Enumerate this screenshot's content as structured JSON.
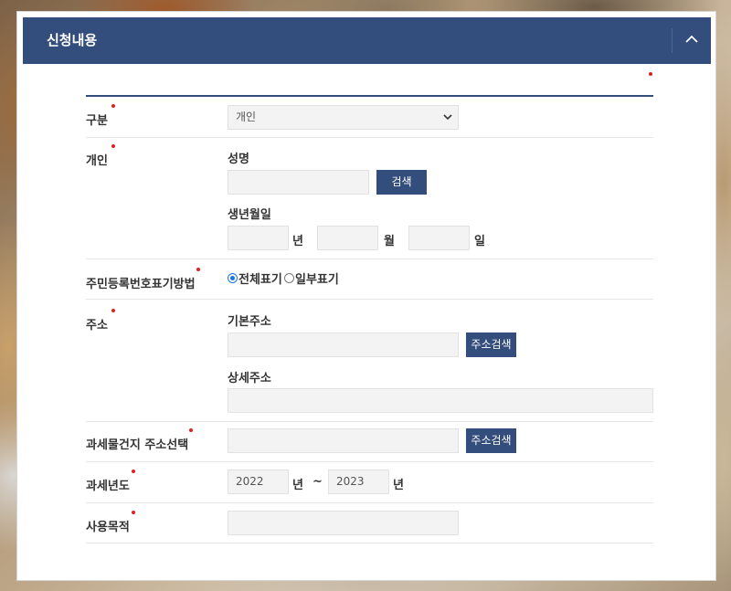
{
  "panel": {
    "title": "신청내용",
    "collapse_icon": "chevron-up-icon"
  },
  "form": {
    "category": {
      "label": "구분",
      "selected": "개인",
      "icon": "chevron-down-icon"
    },
    "individual": {
      "label": "개인",
      "name_label": "성명",
      "name_value": "",
      "search_button": "검색",
      "birth_label": "생년월일",
      "year_value": "",
      "year_unit": "년",
      "month_value": "",
      "month_unit": "월",
      "day_value": "",
      "day_unit": "일"
    },
    "resident_number_display": {
      "label": "주민등록번호표기방법",
      "options": [
        "전체표기",
        "일부표기"
      ],
      "selected": "전체표기"
    },
    "address": {
      "label": "주소",
      "basic_label": "기본주소",
      "basic_value": "",
      "search_button": "주소검색",
      "detail_label": "상세주소",
      "detail_value": ""
    },
    "taxable_property_address": {
      "label": "과세물건지 주소선택",
      "value": "",
      "search_button": "주소검색"
    },
    "tax_year": {
      "label": "과세년도",
      "from_value": "2022",
      "from_unit": "년",
      "separator": "~",
      "to_value": "2023",
      "to_unit": "년"
    },
    "purpose": {
      "label": "사용목적",
      "value": ""
    }
  },
  "colors": {
    "header_bg": "#334d7c",
    "button_bg": "#334d7c",
    "required_dot": "#e02020",
    "input_bg": "#f3f3f3"
  }
}
